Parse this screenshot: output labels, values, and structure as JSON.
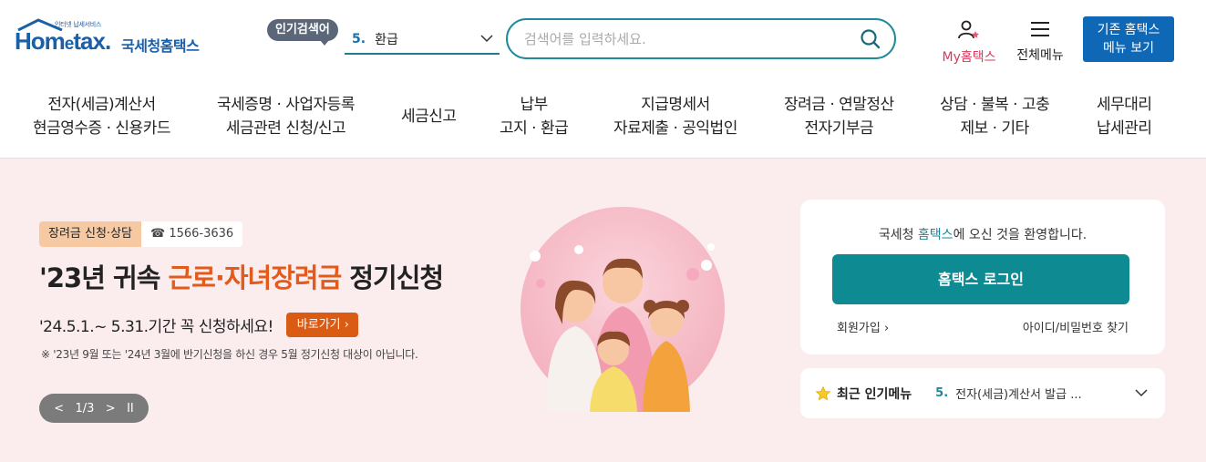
{
  "header": {
    "logo_tagline": "인터넷 납세서비스",
    "logo_word_pre": "Hom",
    "logo_word_e": "e",
    "logo_word_post": "tax.",
    "logo_kr": "국세청홈택스",
    "popular_badge": "인기검색어",
    "popular_num": "5.",
    "popular_term": "환급",
    "search_placeholder": "검색어를 입력하세요.",
    "my_hometax": "My홈택스",
    "all_menu": "전체메뉴",
    "legacy_line1": "기존 홈택스",
    "legacy_line2": "메뉴 보기"
  },
  "nav": [
    {
      "line1": "전자(세금)계산서",
      "line2": "현금영수증 · 신용카드"
    },
    {
      "line1": "국세증명 · 사업자등록",
      "line2": "세금관련 신청/신고"
    },
    {
      "line1": "세금신고",
      "line2": ""
    },
    {
      "line1": "납부",
      "line2": "고지 · 환급"
    },
    {
      "line1": "지급명세서",
      "line2": "자료제출 · 공익법인"
    },
    {
      "line1": "장려금 · 연말정산",
      "line2": "전자기부금"
    },
    {
      "line1": "상담 · 불복 · 고충",
      "line2": "제보 · 기타"
    },
    {
      "line1": "세무대리",
      "line2": "납세관리"
    }
  ],
  "banner": {
    "tag_category": "장려금 신청·상담",
    "tag_phone": "☎ 1566-3636",
    "title_pre": "'23년 귀속 ",
    "title_hl": "근로·자녀장려금",
    "title_post": " 정기신청",
    "subline": "'24.5.1.~ 5.31.기간 꼭 신청하세요!",
    "go_button": "바로가기",
    "note": "※ '23년 9월 또는 '24년 3월에 반기신청을 하신 경우 5월 정기신청 대상이 아닙니다.",
    "slider_prev": "<",
    "slider_page": "1/3",
    "slider_next": ">",
    "slider_pause": "II"
  },
  "login": {
    "welcome_pre": "국세청 ",
    "welcome_brand": "홈택스",
    "welcome_post": "에 오신 것을 환영합니다.",
    "login_button": "홈택스 로그인",
    "join": "회원가입",
    "find": "아이디/비밀번호 찾기"
  },
  "recent": {
    "title": "최근 인기메뉴",
    "num": "5.",
    "item": "전자(세금)계산서 발급 ..."
  },
  "colors": {
    "brand_blue": "#1a5fa8",
    "teal": "#0e8a93",
    "banner_bg": "#fbecee",
    "accent_orange": "#e25b1b"
  }
}
